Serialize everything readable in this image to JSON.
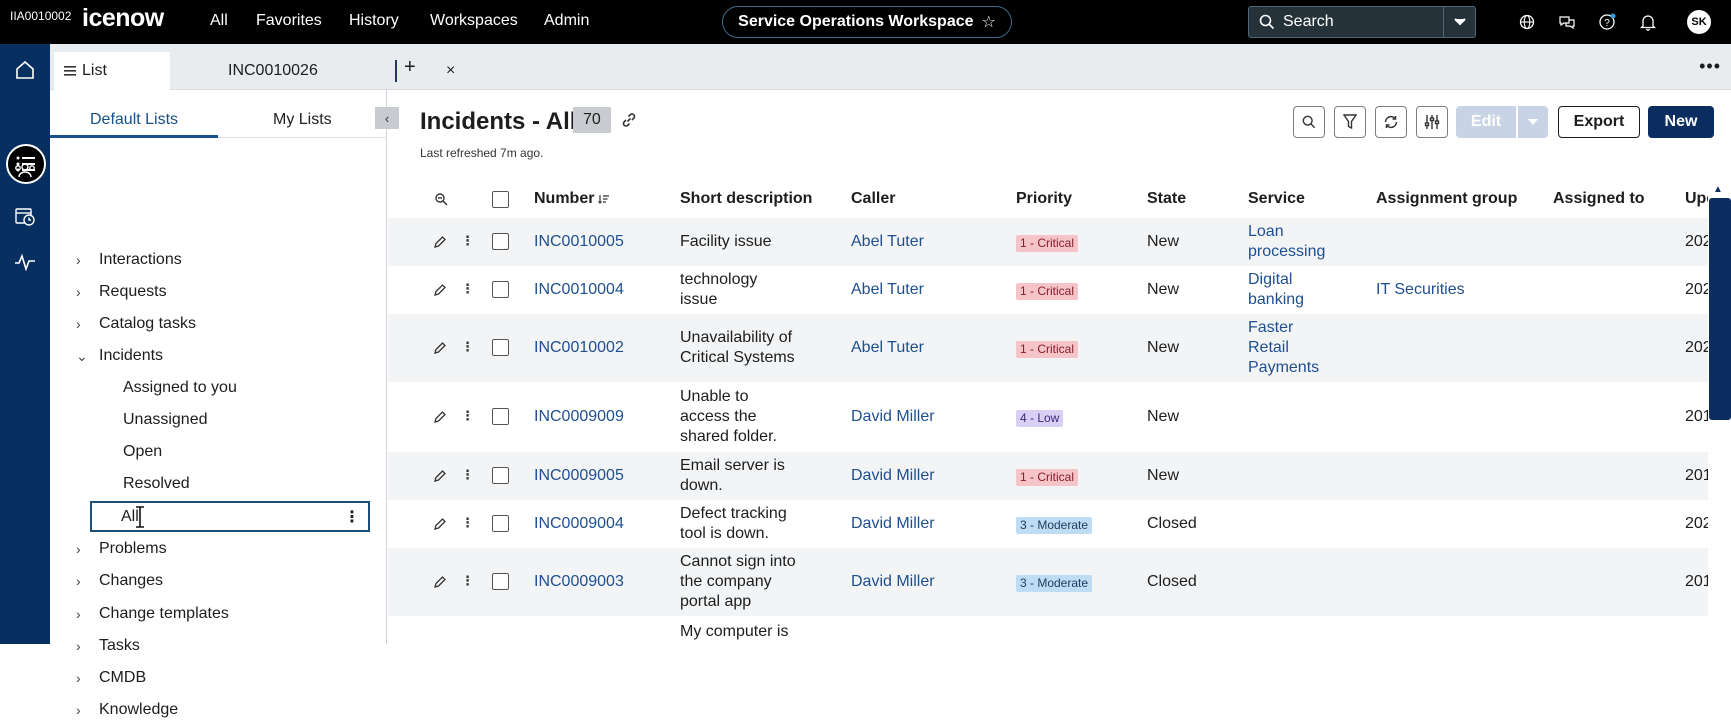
{
  "topbar": {
    "instance_label": "IIA0010002",
    "logo_text": "icenow",
    "nav": [
      "All",
      "Favorites",
      "History",
      "Workspaces",
      "Admin"
    ],
    "workspace_title": "Service Operations Workspace",
    "search_label": "Search",
    "avatar_initials": "SK"
  },
  "tabs": {
    "list_label": "List",
    "record_label": "INC0010026",
    "close_symbol": "×",
    "add_symbol": "+",
    "more_symbol": "•••"
  },
  "left_panel": {
    "tab_default": "Default Lists",
    "tab_my": "My Lists",
    "collapse_symbol": "‹",
    "items": [
      {
        "label": "Interactions",
        "expanded": false
      },
      {
        "label": "Requests",
        "expanded": false
      },
      {
        "label": "Catalog tasks",
        "expanded": false
      },
      {
        "label": "Incidents",
        "expanded": true
      },
      {
        "label": "Problems",
        "expanded": false
      },
      {
        "label": "Changes",
        "expanded": false
      },
      {
        "label": "Change templates",
        "expanded": false
      },
      {
        "label": "Tasks",
        "expanded": false
      },
      {
        "label": "CMDB",
        "expanded": false
      },
      {
        "label": "Knowledge",
        "expanded": false
      }
    ],
    "incident_children": [
      "Assigned to you",
      "Unassigned",
      "Open",
      "Resolved",
      "All"
    ],
    "selected": "All"
  },
  "main": {
    "title": "Incidents - All",
    "count": "70",
    "refreshed": "Last refreshed 7m ago.",
    "edit_label": "Edit",
    "export_label": "Export",
    "new_label": "New",
    "columns": [
      "Number",
      "Short description",
      "Caller",
      "Priority",
      "State",
      "Service",
      "Assignment group",
      "Assigned to",
      "Upd"
    ],
    "rows": [
      {
        "number": "INC0010005",
        "desc": [
          "Facility issue"
        ],
        "caller": "Abel Tuter",
        "priority": "1 - Critical",
        "state": "New",
        "service": [
          "Loan",
          "processing"
        ],
        "group": "",
        "updated": "202"
      },
      {
        "number": "INC0010004",
        "desc": [
          "technology",
          "issue"
        ],
        "caller": "Abel Tuter",
        "priority": "1 - Critical",
        "state": "New",
        "service": [
          "Digital",
          "banking"
        ],
        "group": "IT Securities",
        "updated": "202"
      },
      {
        "number": "INC0010002",
        "desc": [
          "Unavailability of",
          "Critical Systems"
        ],
        "caller": "Abel Tuter",
        "priority": "1 - Critical",
        "state": "New",
        "service": [
          "Faster",
          "Retail",
          "Payments"
        ],
        "group": "",
        "updated": "202"
      },
      {
        "number": "INC0009009",
        "desc": [
          "Unable to",
          "access the",
          "shared folder."
        ],
        "caller": "David Miller",
        "priority": "4 - Low",
        "state": "New",
        "service": [],
        "group": "",
        "updated": "201"
      },
      {
        "number": "INC0009005",
        "desc": [
          "Email server is",
          "down."
        ],
        "caller": "David Miller",
        "priority": "1 - Critical",
        "state": "New",
        "service": [],
        "group": "",
        "updated": "201"
      },
      {
        "number": "INC0009004",
        "desc": [
          "Defect tracking",
          "tool is down."
        ],
        "caller": "David Miller",
        "priority": "3 - Moderate",
        "state": "Closed",
        "service": [],
        "group": "",
        "updated": "202"
      },
      {
        "number": "INC0009003",
        "desc": [
          "Cannot sign into",
          "the company",
          "portal app"
        ],
        "caller": "David Miller",
        "priority": "3 - Moderate",
        "state": "Closed",
        "service": [],
        "group": "",
        "updated": "201"
      },
      {
        "number": "",
        "desc": [
          "My computer is"
        ],
        "caller": "",
        "priority": "",
        "state": "",
        "service": [],
        "group": "",
        "updated": ""
      }
    ]
  }
}
